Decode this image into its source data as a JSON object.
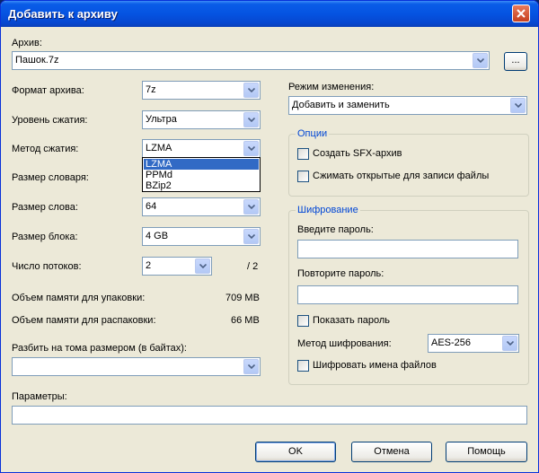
{
  "window": {
    "title": "Добавить к архиву"
  },
  "archive": {
    "label": "Архив:",
    "value": "Пашок.7z",
    "browse_label": "..."
  },
  "format": {
    "label": "Формат архива:",
    "value": "7z"
  },
  "level": {
    "label": "Уровень сжатия:",
    "value": "Ультра"
  },
  "method": {
    "label": "Метод сжатия:",
    "value": "LZMA",
    "options": [
      "LZMA",
      "PPMd",
      "BZip2"
    ],
    "selected_option": "LZMA"
  },
  "dict": {
    "label": "Размер словаря:"
  },
  "word": {
    "label": "Размер слова:",
    "value": "64"
  },
  "block": {
    "label": "Размер блока:",
    "value": "4 GB"
  },
  "threads": {
    "label": "Число потоков:",
    "value": "2",
    "max": "/ 2"
  },
  "mem_pack": {
    "label": "Объем памяти для упаковки:",
    "value": "709 MB"
  },
  "mem_unpack": {
    "label": "Объем памяти для распаковки:",
    "value": "66 MB"
  },
  "split": {
    "label": "Разбить на тома размером (в байтах):",
    "value": ""
  },
  "params": {
    "label": "Параметры:",
    "value": ""
  },
  "update_mode": {
    "label": "Режим изменения:",
    "value": "Добавить и заменить"
  },
  "options": {
    "caption": "Опции",
    "sfx_label": "Создать SFX-архив",
    "sfx_checked": false,
    "shared_label": "Сжимать открытые для записи файлы",
    "shared_checked": false
  },
  "encryption": {
    "caption": "Шифрование",
    "password_label": "Введите пароль:",
    "password_value": "",
    "repeat_label": "Повторите пароль:",
    "repeat_value": "",
    "show_label": "Показать пароль",
    "show_checked": false,
    "method_label": "Метод шифрования:",
    "method_value": "AES-256",
    "names_label": "Шифровать имена файлов",
    "names_checked": false
  },
  "buttons": {
    "ok": "OK",
    "cancel": "Отмена",
    "help": "Помощь"
  },
  "colors": {
    "titlebar": "#0553e1",
    "dialog_bg": "#ece9d8",
    "group_caption": "#0046d5",
    "selection": "#316ac5"
  }
}
